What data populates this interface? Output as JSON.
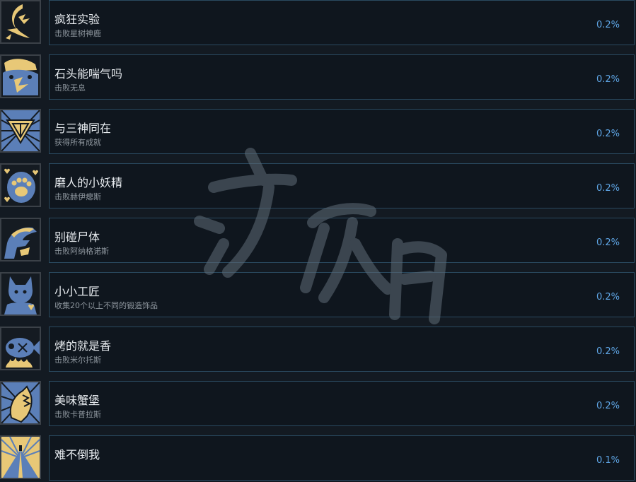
{
  "achievements": [
    {
      "title": "疯狂实验",
      "desc": "击败星树神鹿",
      "percent": "0.2%",
      "icon": "moon-deer-icon"
    },
    {
      "title": "石头能喘气吗",
      "desc": "击败无息",
      "percent": "0.2%",
      "icon": "rock-creature-icon"
    },
    {
      "title": "与三神同在",
      "desc": "获得所有成就",
      "percent": "0.2%",
      "icon": "triangle-sigil-icon"
    },
    {
      "title": "磨人的小妖精",
      "desc": "击败赫伊瘪斯",
      "percent": "0.2%",
      "icon": "paw-hearts-icon"
    },
    {
      "title": "别碰尸体",
      "desc": "击败阿纳格诺斯",
      "percent": "0.2%",
      "icon": "corpse-hand-icon"
    },
    {
      "title": "小小工匠",
      "desc": "收集20个以上不同的锻造饰品",
      "percent": "0.2%",
      "icon": "craftsman-fox-icon"
    },
    {
      "title": "烤的就是香",
      "desc": "击败米尔托斯",
      "percent": "0.2%",
      "icon": "roasted-fish-icon"
    },
    {
      "title": "美味蟹堡",
      "desc": "击败卡普拉斯",
      "percent": "0.2%",
      "icon": "crab-icon"
    },
    {
      "title": "难不倒我",
      "desc": "",
      "percent": "0.1%",
      "icon": "pyramid-icon"
    }
  ],
  "colors": {
    "background": "#131a22",
    "panel": "#0f161e",
    "panel_border": "#2a4a60",
    "percent_text": "#5fa6e6",
    "icon_gold": "#e8c877",
    "icon_blue": "#5b7fb8"
  }
}
